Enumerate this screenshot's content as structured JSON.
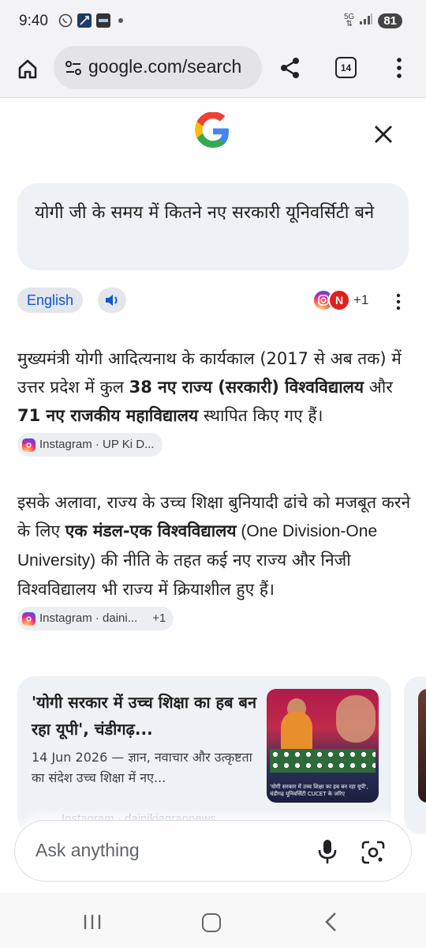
{
  "status_bar": {
    "time": "9:40",
    "network": "5G",
    "battery": "81"
  },
  "browser": {
    "url": "google.com/search",
    "tab_count": "14"
  },
  "query": {
    "text": "योगी जी के समय में कितने नए सरकारी यूनिवर्सिटी बने"
  },
  "language": {
    "label": "English",
    "sources_more": "+1"
  },
  "answer": {
    "p1": {
      "t1": "मुख्यमंत्री योगी आदित्यनाथ के कार्यकाल (2017 से अब तक) में उत्तर प्रदेश में कुल ",
      "b1": "38 नए राज्य (सरकारी) विश्वविद्यालय",
      "t2": " और ",
      "b2": "71 नए राजकीय महाविद्यालय",
      "t3": " स्थापित किए गए हैं। ",
      "cite": "Instagram · UP Ki D..."
    },
    "p2": {
      "t1": "इसके अलावा, राज्य के उच्च शिक्षा बुनियादी ढांचे को मजबूत करने के लिए ",
      "b1": "एक मंडल-एक विश्वविद्यालय",
      "t2": " (One Division-One University)",
      "t3": " की नीति के तहत कई नए राज्य और निजी विश्वविद्यालय भी राज्य में क्रियाशील हुए हैं। ",
      "cite": "Instagram · daini...",
      "cite_more": "+1"
    }
  },
  "card": {
    "title": "'योगी सरकार में उच्च शिक्षा का हब बन रहा यूपी', चंडीगढ़...",
    "snippet": "14 Jun 2026 — ज्ञान, नवाचार और उत्कृष्टता का संदेश उच्च शिक्षा में नए...",
    "source": "Instagram · dainikjagrannews",
    "image_caption": "'योगी सरकार में उच्च शिक्षा का हब बन रहा यूपी', चंडीगढ़ यूनिवर्सिटी CUCET के जरिए"
  },
  "ask": {
    "placeholder": "Ask anything"
  },
  "icons": {
    "home": "home-icon",
    "share": "share-icon",
    "menu": "more-vert-icon",
    "close": "close-icon",
    "speaker": "speaker-icon",
    "mic": "mic-icon",
    "lens": "lens-icon"
  },
  "colors": {
    "accent": "#0b57d0",
    "bubble": "#eef1f6",
    "chrome": "#f3f3f5"
  }
}
